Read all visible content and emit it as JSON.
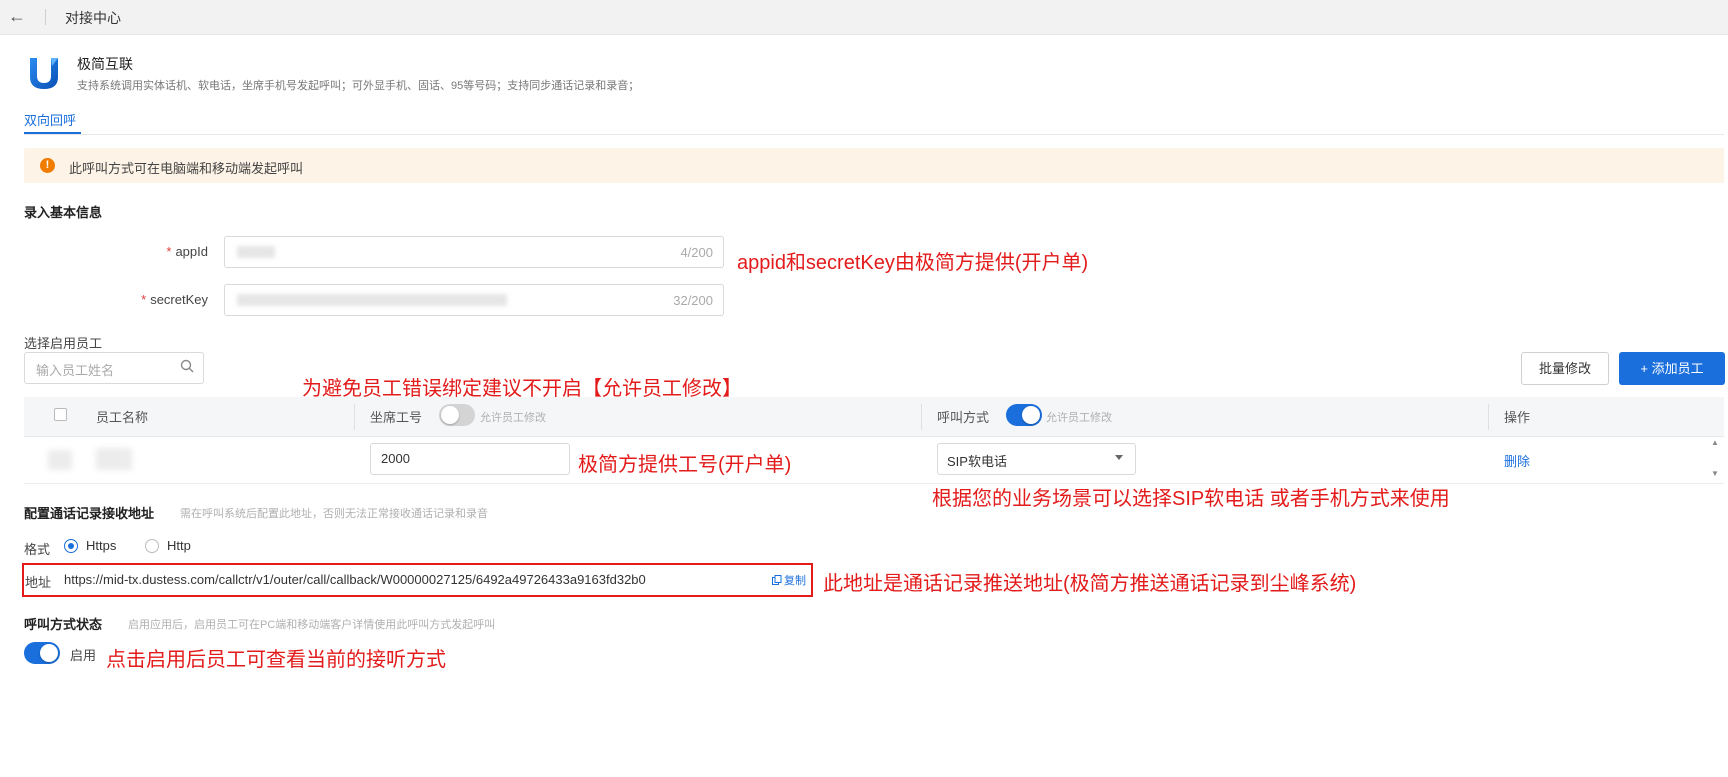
{
  "topbar": {
    "back_icon": "←",
    "title": "对接中心"
  },
  "brand": {
    "logo_icon": "brand-logo-u",
    "name": "极简互联",
    "desc": "支持系统调用实体话机、软电话，坐席手机号发起呼叫；可外显手机、固话、95等号码；支持同步通话记录和录音；"
  },
  "tabs": [
    {
      "label": "双向回呼",
      "active": true
    }
  ],
  "alert": {
    "icon": "!",
    "text": "此呼叫方式可在电脑端和移动端发起呼叫"
  },
  "basic_info": {
    "title": "录入基本信息",
    "appid": {
      "label": "appId",
      "count": "4/200"
    },
    "secret": {
      "label": "secretKey",
      "count": "32/200"
    }
  },
  "staff": {
    "title": "选择启用员工",
    "search_placeholder": "输入员工姓名",
    "batch_button": "批量修改",
    "add_button": "+ 添加员工",
    "columns": {
      "name": "员工名称",
      "agent_no": "坐席工号",
      "agent_no_hint": "允许员工修改",
      "call_mode": "呼叫方式",
      "call_mode_hint": "允许员工修改",
      "actions": "操作"
    },
    "rows": [
      {
        "agent_no": "2000",
        "call_mode": "SIP软电话",
        "action": "删除"
      }
    ]
  },
  "callback": {
    "title": "配置通话记录接收地址",
    "hint": "需在呼叫系统后配置此地址，否则无法正常接收通话记录和录音",
    "format_label": "格式",
    "options": [
      "Https",
      "Http"
    ],
    "selected": "Https",
    "address_label": "地址",
    "address": "https://mid-tx.dustess.com/callctr/v1/outer/call/callback/W00000027125/6492a49726433a9163fd32b0",
    "copy_label": "复制"
  },
  "status": {
    "title": "呼叫方式状态",
    "hint": "启用应用后，启用员工可在PC端和移动端客户详情使用此呼叫方式发起呼叫",
    "switch_label": "启用",
    "enabled": true
  },
  "annotations": {
    "appid_note": "appid和secretKey由极简方提供(开户单)",
    "switch_note": "为避免员工错误绑定建议不开启【允许员工修改】",
    "agent_note": "极简方提供工号(开户单)",
    "mode_note": "根据您的业务场景可以选择SIP软电话 或者手机方式来使用",
    "address_note": "此地址是通话记录推送地址(极简方推送通话记录到尘峰系统)",
    "enable_note": "点击启用后员工可查看当前的接听方式"
  },
  "colors": {
    "primary": "#1a6fdc",
    "annotation": "#e31b1b",
    "alert_bg": "#fdf3e6",
    "alert_icon": "#f07d00"
  }
}
